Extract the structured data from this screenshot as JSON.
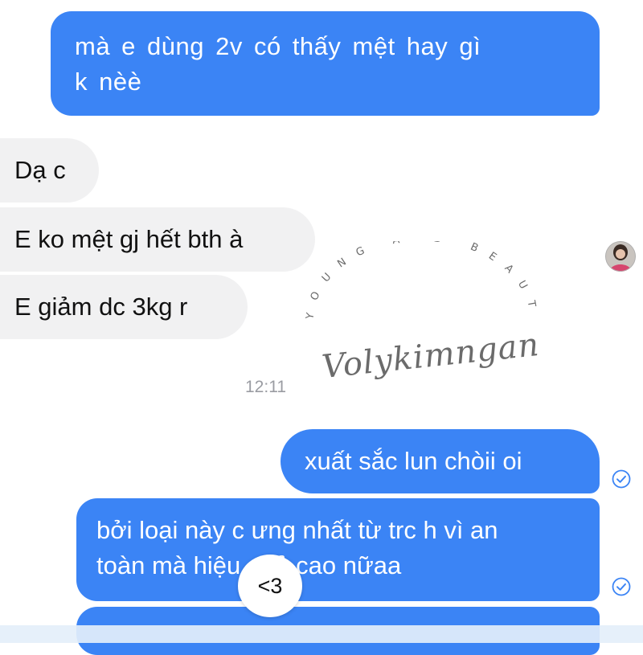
{
  "messages": {
    "msg1": {
      "lines": [
        "mà e dùng 2v có thấy mệt hay gì",
        "k nèè"
      ]
    },
    "msg2": {
      "text": "Dạ c"
    },
    "msg3": {
      "text": "E ko mệt gj hết bth à"
    },
    "msg4": {
      "text": "E giảm dc 3kg r"
    },
    "msg5": {
      "text": "xuất sắc lun chòii  oi"
    },
    "msg6": {
      "lines": [
        "bởi loại này c ưng nhất từ trc h vì an",
        "toàn mà hiệu quả cao nữaa"
      ]
    }
  },
  "timestamp": "12:11",
  "reaction": {
    "text": "<3"
  },
  "watermark": {
    "arc_text": "YOUNG AND BEAUTY",
    "script_text": "Volykimngan"
  },
  "icons": {
    "sent_check": "check-circle-icon",
    "avatar": "contact-avatar"
  },
  "colors": {
    "outgoing_bubble": "#3b84f5",
    "incoming_bubble": "#f1f1f2",
    "timestamp": "#9a9ca2"
  }
}
